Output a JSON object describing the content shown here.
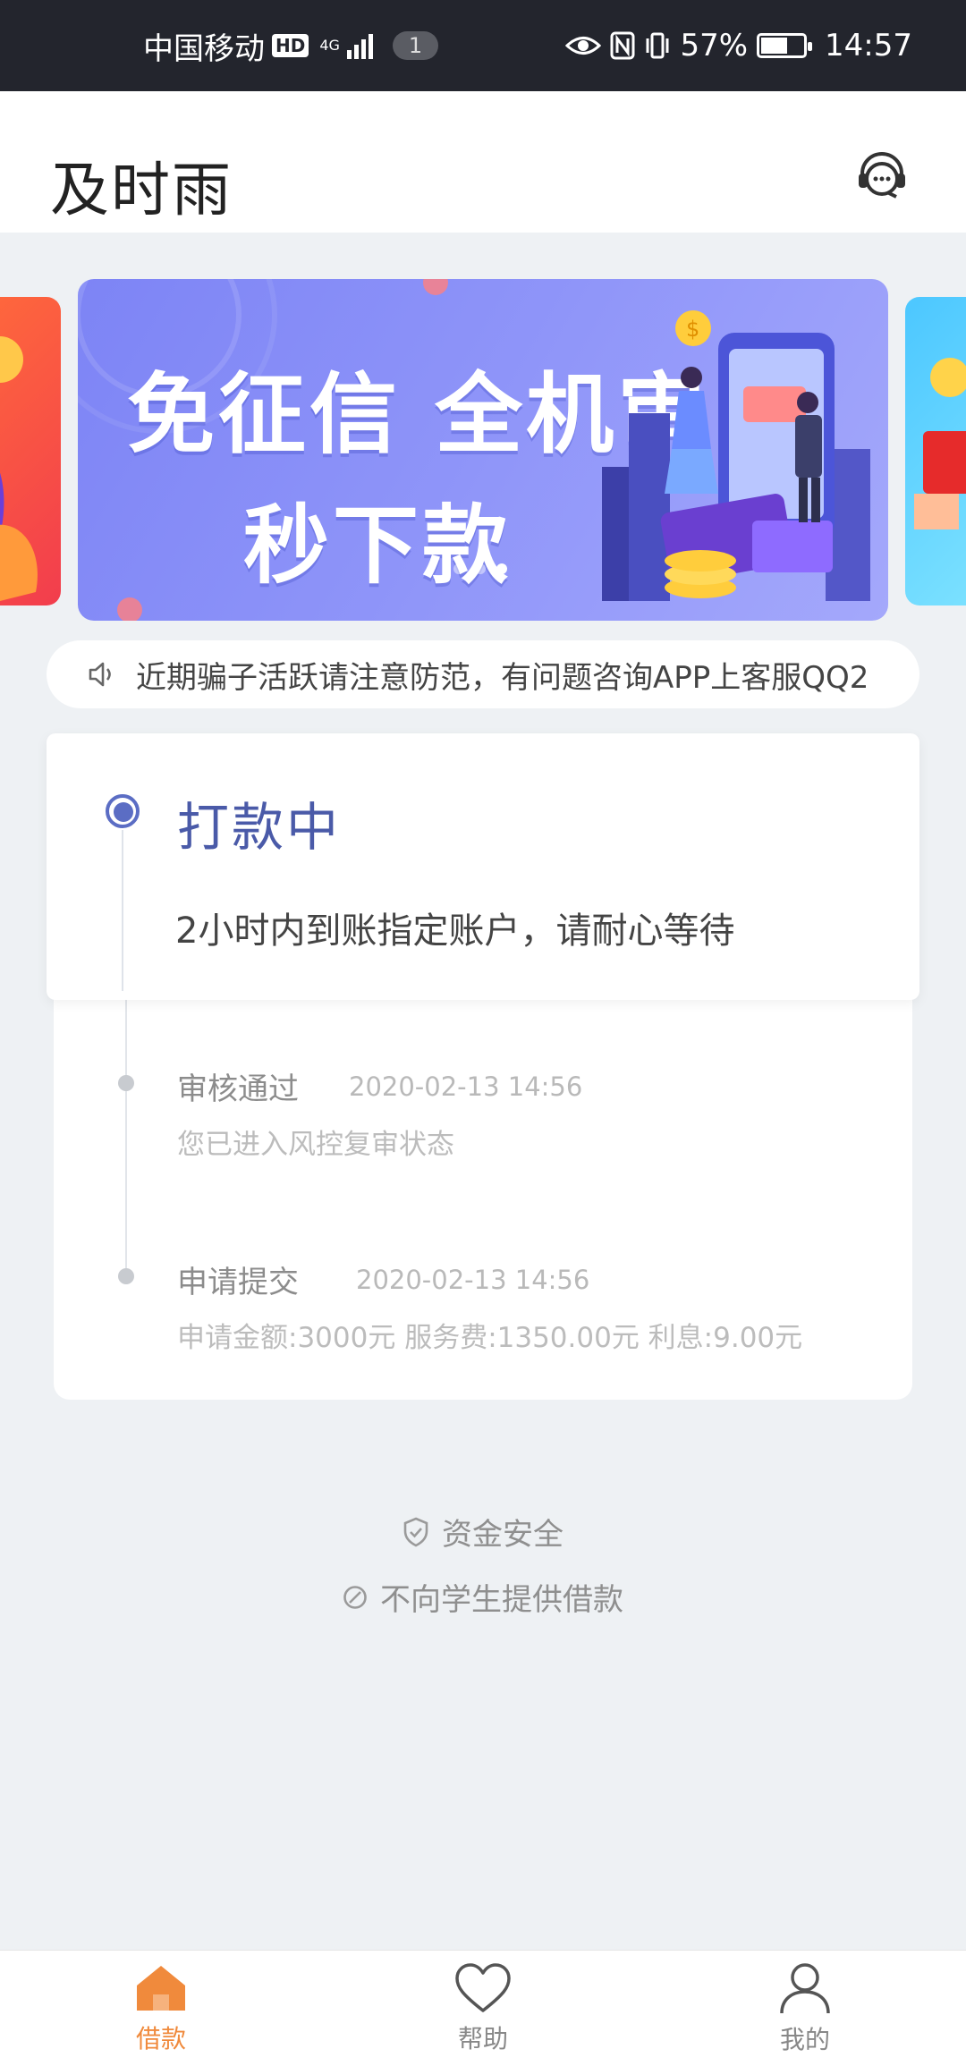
{
  "status_bar": {
    "carrier": "中国移动",
    "hd": "HD",
    "network": "4G",
    "notification_count": "1",
    "battery_percent": "57%",
    "battery_level": 0.57,
    "time": "14:57"
  },
  "header": {
    "title": "及时雨",
    "support_icon": "customer-service-icon"
  },
  "banner": {
    "line1": "免征信  全机审",
    "line2": "秒下款",
    "active_dot": 3,
    "dot_count": 3
  },
  "notice": {
    "icon": "speaker-icon",
    "text": "近期骗子活跃请注意防范，有问题咨询APP上客服QQ2"
  },
  "current_status": {
    "title": "打款中",
    "description": "2小时内到账指定账户，请耐心等待",
    "color": "#4a5aa8"
  },
  "timeline": [
    {
      "title": "审核通过",
      "time": "2020-02-13 14:56",
      "description": "您已进入风控复审状态"
    },
    {
      "title": "申请提交",
      "time": "2020-02-13 14:56",
      "description": "申请金额:3000元  服务费:1350.00元 利息:9.00元"
    }
  ],
  "assurances": [
    {
      "icon": "shield-check-icon",
      "text": "资金安全"
    },
    {
      "icon": "no-entry-icon",
      "text": "不向学生提供借款"
    }
  ],
  "bottom_nav": {
    "accent": "#f08a3c",
    "items": [
      {
        "label": "借款",
        "icon": "home-icon",
        "active": true
      },
      {
        "label": "帮助",
        "icon": "heart-icon",
        "active": false
      },
      {
        "label": "我的",
        "icon": "person-icon",
        "active": false
      }
    ]
  }
}
